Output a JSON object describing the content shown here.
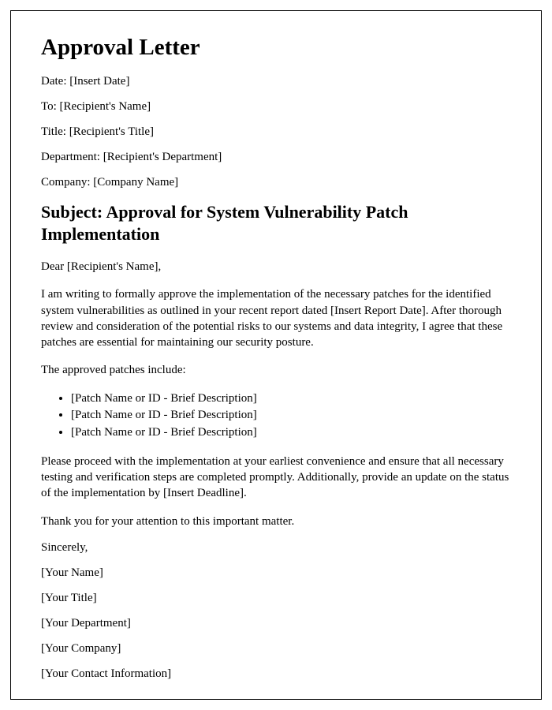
{
  "title": "Approval Letter",
  "header": {
    "date_label": "Date:",
    "date_value": "[Insert Date]",
    "to_label": "To:",
    "to_value": "[Recipient's Name]",
    "title_label": "Title:",
    "title_value": "[Recipient's Title]",
    "department_label": "Department:",
    "department_value": "[Recipient's Department]",
    "company_label": "Company:",
    "company_value": "[Company Name]"
  },
  "subject": "Subject: Approval for System Vulnerability Patch Implementation",
  "salutation": "Dear [Recipient's Name],",
  "para1": "I am writing to formally approve the implementation of the necessary patches for the identified system vulnerabilities as outlined in your recent report dated [Insert Report Date]. After thorough review and consideration of the potential risks to our systems and data integrity, I agree that these patches are essential for maintaining our security posture.",
  "patches_intro": "The approved patches include:",
  "patches": [
    "[Patch Name or ID - Brief Description]",
    "[Patch Name or ID - Brief Description]",
    "[Patch Name or ID - Brief Description]"
  ],
  "para2": "Please proceed with the implementation at your earliest convenience and ensure that all necessary testing and verification steps are completed promptly. Additionally, provide an update on the status of the implementation by [Insert Deadline].",
  "para3": "Thank you for your attention to this important matter.",
  "closing": "Sincerely,",
  "signature": {
    "name": "[Your Name]",
    "title": "[Your Title]",
    "department": "[Your Department]",
    "company": "[Your Company]",
    "contact": "[Your Contact Information]"
  }
}
